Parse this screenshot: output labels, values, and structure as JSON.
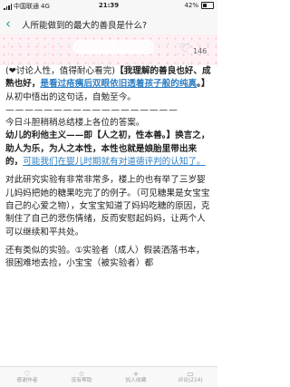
{
  "status_bar": {
    "carrier": "中国联通",
    "network": "4G",
    "time": "21:39",
    "battery": "42%"
  },
  "header": {
    "back_icon": "‹",
    "title": "人所能做到的最大的善良是什么?"
  },
  "banner": {
    "likes": "146"
  },
  "content": {
    "p1_a": "(❤讨论人性，值得耐心看完)",
    "p1_b": "【我理解的善良也好、成熟也好，",
    "p1_link": "是看过疮痍后双眼依旧透着孩子般的纯真",
    "p1_end": "。】",
    "p2": "从初中悟出的这句话，自勉至今。",
    "divider": "——————————————————",
    "p3": "今日斗胆稍稍总结楼上各位的答案。",
    "p4_a": "幼儿的利他主义——即",
    "p4_b": "【人之初，性本善。】",
    "p4_c": "换言之，助人为乐，为人之本性，本性也就是娘胎里带出来的，",
    "p4_link": "可能我们在婴儿时期就有对道德评判的认知了。",
    "p5": "对此研究实验有非常非常多，楼上的也有举了三岁婴儿妈妈把她的糖果吃完了的例子。（可见糖果是女宝宝自己的心爱之物），女宝宝知道了妈妈吃糖的原因，克制住了自己的悲伤情绪，反而安慰起妈妈，让两个人可以继续和平共处。",
    "p6": "还有类似的实验。①实验者（成人）假装洒落书本，很困难地去捡，小宝宝（被实验者）都"
  },
  "tabs": [
    {
      "icon": "♡",
      "label": "感谢作者"
    },
    {
      "icon": "☆",
      "label": "没有帮助"
    },
    {
      "icon": "+",
      "label": "加入收藏"
    },
    {
      "icon": "▭",
      "label": "评论(214)"
    }
  ],
  "colors": {
    "accent": "#1aa7a7",
    "link": "#2f7fc4"
  }
}
